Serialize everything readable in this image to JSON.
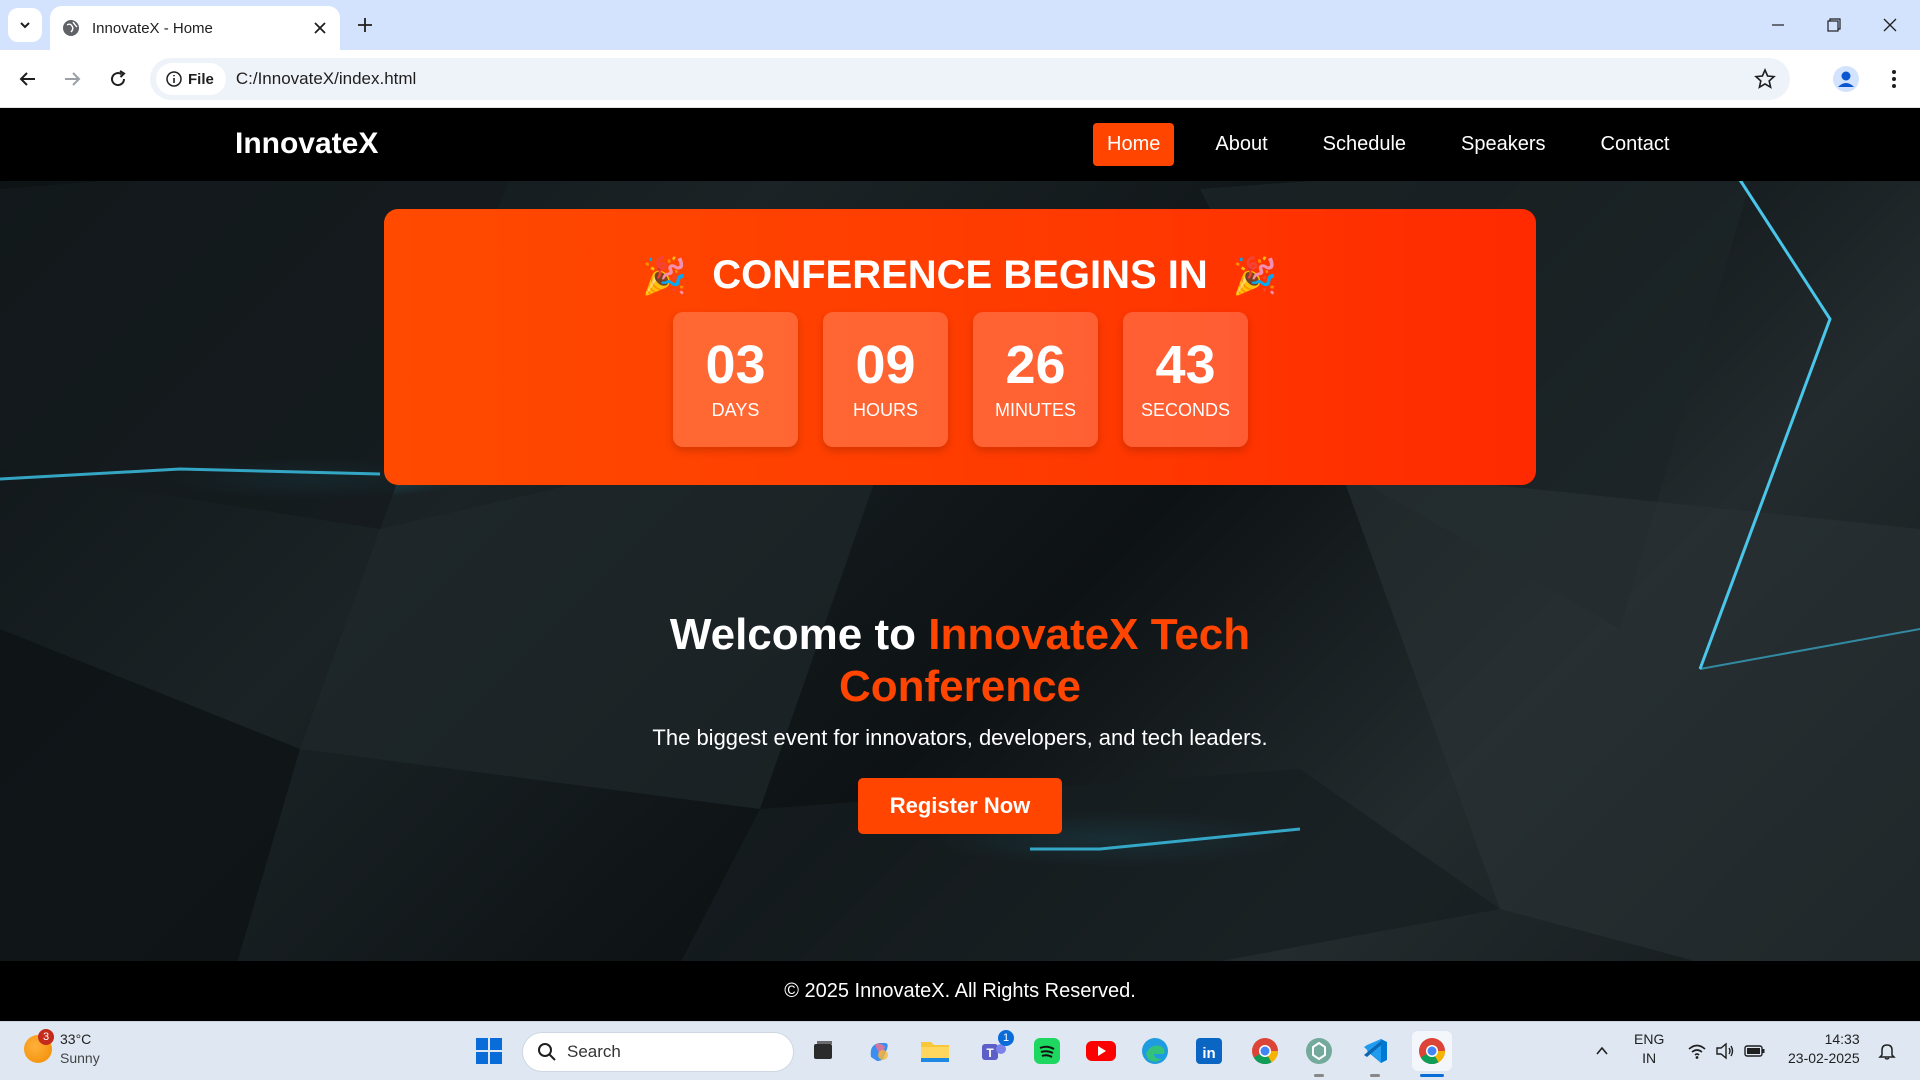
{
  "browser": {
    "tab_title": "InnovateX - Home",
    "site_chip": "File",
    "url": "C:/InnovateX/index.html"
  },
  "site": {
    "logo": "InnovateX",
    "nav": [
      {
        "label": "Home",
        "active": true
      },
      {
        "label": "About",
        "active": false
      },
      {
        "label": "Schedule",
        "active": false
      },
      {
        "label": "Speakers",
        "active": false
      },
      {
        "label": "Contact",
        "active": false
      }
    ],
    "countdown": {
      "title": "CONFERENCE BEGINS IN",
      "emoji": "🎉",
      "units": [
        {
          "value": "03",
          "label": "DAYS"
        },
        {
          "value": "09",
          "label": "HOURS"
        },
        {
          "value": "26",
          "label": "MINUTES"
        },
        {
          "value": "43",
          "label": "SECONDS"
        }
      ]
    },
    "hero": {
      "heading_plain": "Welcome to ",
      "heading_accent": "InnovateX Tech Conference",
      "subtitle": "The biggest event for innovators, developers, and tech leaders.",
      "cta": "Register Now"
    },
    "footer": "© 2025 InnovateX. All Rights Reserved.",
    "colors": {
      "accent": "#ff4500",
      "nav_bg": "#000000",
      "countdown_bg": "#ff3a00"
    }
  },
  "taskbar": {
    "weather": {
      "temp": "33°C",
      "condition": "Sunny",
      "badge": "3"
    },
    "search_placeholder": "Search",
    "teams_badge": "1",
    "language": {
      "line1": "ENG",
      "line2": "IN"
    },
    "clock": {
      "time": "14:33",
      "date": "23-02-2025"
    },
    "apps": [
      "start-icon",
      "task-view-icon",
      "copilot-icon",
      "file-explorer-icon",
      "teams-icon",
      "spotify-icon",
      "youtube-icon",
      "edge-icon",
      "linkedin-icon",
      "chrome-icon",
      "chatgpt-icon",
      "vscode-icon",
      "chrome-active-icon"
    ]
  }
}
